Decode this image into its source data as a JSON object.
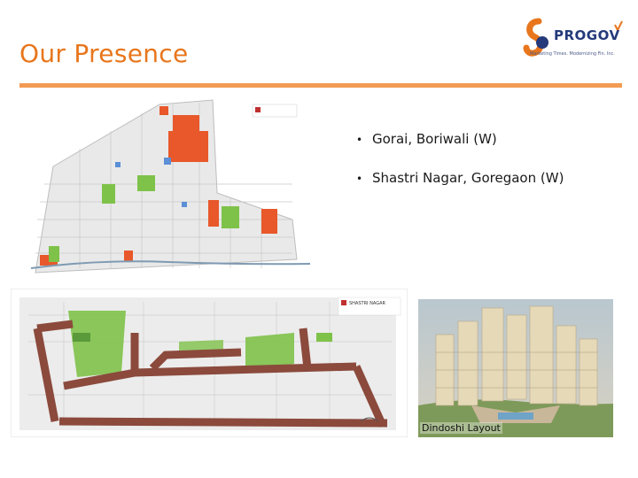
{
  "slide": {
    "title": "Our Presence",
    "bullets": [
      "Gorai, Boriwali (W)",
      "Shastri Nagar, Goregaon (W)"
    ],
    "photo_caption": "Dindoshi Layout"
  },
  "brand": {
    "name": "PROGOV",
    "tagline": "Marketing Times. Modernizing Fin. Inc."
  },
  "maps": {
    "map2_label": "SHASTRI NAGAR"
  },
  "colors": {
    "title": "#e8761c",
    "rule": "#f29b53",
    "road": "#8b4a3c",
    "green": "#7fc24a",
    "orange": "#e8582a",
    "blue": "#5b8fd6"
  }
}
